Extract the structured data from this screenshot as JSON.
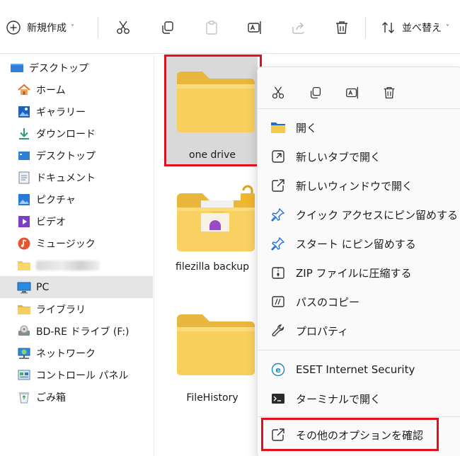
{
  "toolbar": {
    "new_label": "新規作成",
    "sort_label": "並べ替え"
  },
  "sidebar": {
    "items": [
      {
        "label": "デスクトップ",
        "icon": "desktop-icon"
      },
      {
        "label": "ホーム",
        "icon": "home-icon"
      },
      {
        "label": "ギャラリー",
        "icon": "gallery-icon"
      },
      {
        "label": "ダウンロード",
        "icon": "download-icon"
      },
      {
        "label": "デスクトップ",
        "icon": "desktop-small-icon"
      },
      {
        "label": "ドキュメント",
        "icon": "document-icon"
      },
      {
        "label": "ピクチャ",
        "icon": "pictures-icon"
      },
      {
        "label": "ビデオ",
        "icon": "video-icon"
      },
      {
        "label": "ミュージック",
        "icon": "music-icon"
      },
      {
        "label": "",
        "icon": "folder-icon"
      },
      {
        "label": "PC",
        "icon": "pc-icon"
      },
      {
        "label": "ライブラリ",
        "icon": "library-icon"
      },
      {
        "label": "BD-RE ドライブ (F:)",
        "icon": "drive-icon"
      },
      {
        "label": "ネットワーク",
        "icon": "network-icon"
      },
      {
        "label": "コントロール パネル",
        "icon": "control-panel-icon"
      },
      {
        "label": "ごみ箱",
        "icon": "recycle-bin-icon"
      }
    ],
    "selected": "PC"
  },
  "folders": [
    {
      "name": "one drive"
    },
    {
      "name": "filezilla backup"
    },
    {
      "name": "FileHistory"
    }
  ],
  "context_menu": {
    "items": [
      {
        "label": "開く",
        "icon": "folder-open-icon"
      },
      {
        "label": "新しいタブで開く",
        "icon": "new-tab-icon"
      },
      {
        "label": "新しいウィンドウで開く",
        "icon": "new-window-icon"
      },
      {
        "label": "クイック アクセスにピン留めする",
        "icon": "pin-icon"
      },
      {
        "label": "スタート にピン留めする",
        "icon": "pin-start-icon"
      },
      {
        "label": "ZIP ファイルに圧縮する",
        "icon": "zip-icon"
      },
      {
        "label": "パスのコピー",
        "icon": "copy-path-icon"
      },
      {
        "label": "プロパティ",
        "icon": "wrench-icon"
      },
      {
        "label": "ESET Internet Security",
        "icon": "eset-icon"
      },
      {
        "label": "ターミナルで開く",
        "icon": "terminal-icon"
      },
      {
        "label": "その他のオプションを確認",
        "icon": "more-options-icon"
      }
    ]
  },
  "colors": {
    "highlight_red": "#e3101c",
    "folder_yellow": "#f7c94b",
    "accent_blue": "#1f6fd1"
  }
}
